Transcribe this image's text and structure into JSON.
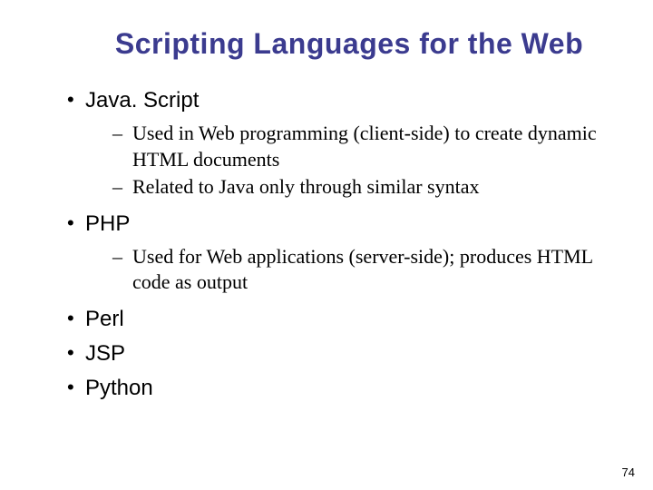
{
  "slide": {
    "title": "Scripting Languages for the Web",
    "bullets": [
      {
        "label": "Java. Script",
        "subs": [
          "Used in Web programming (client-side) to create dynamic HTML documents",
          "Related to Java only through similar syntax"
        ]
      },
      {
        "label": "PHP",
        "subs": [
          "Used for Web applications (server-side); produces HTML code as output"
        ]
      },
      {
        "label": "Perl",
        "subs": []
      },
      {
        "label": "JSP",
        "subs": []
      },
      {
        "label": "Python",
        "subs": []
      }
    ],
    "page_number": "74"
  }
}
